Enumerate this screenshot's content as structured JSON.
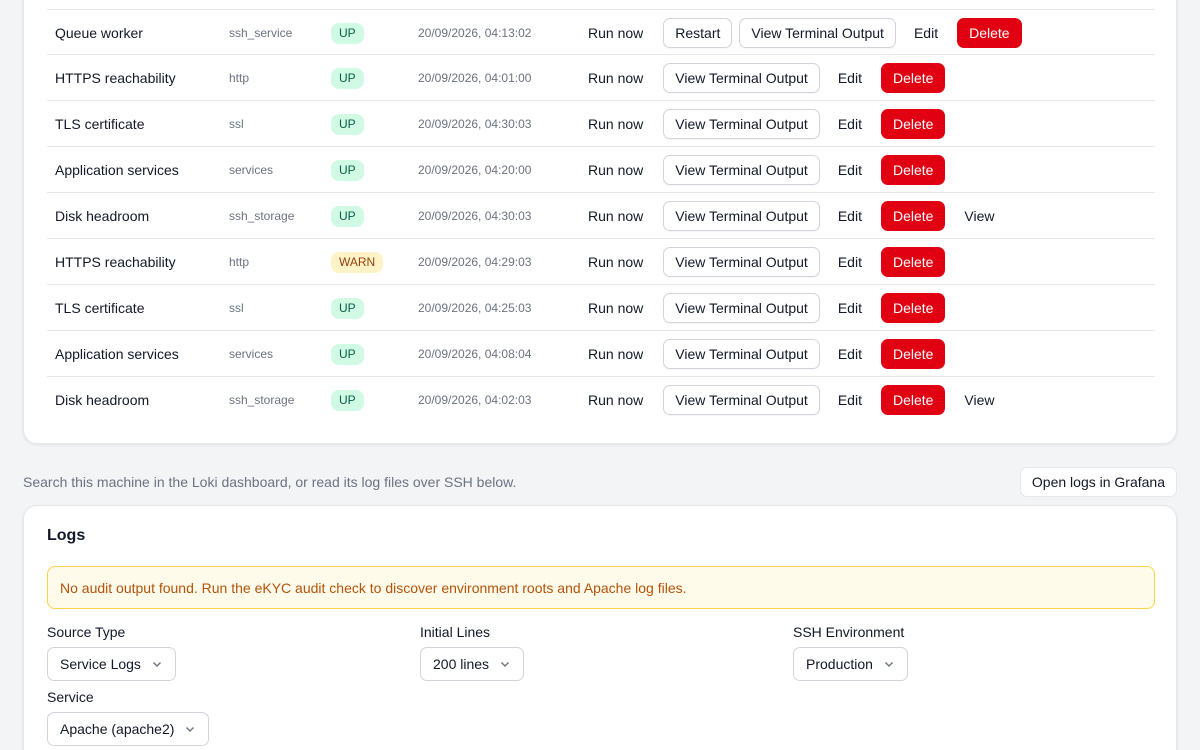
{
  "checks": [
    {
      "name": "Queue worker",
      "type": "ssh_service",
      "status": "UP",
      "time": "20/09/2026, 04:13:02",
      "restart": true,
      "view": false
    },
    {
      "name": "HTTPS reachability",
      "type": "http",
      "status": "UP",
      "time": "20/09/2026, 04:01:00",
      "restart": false,
      "view": false
    },
    {
      "name": "TLS certificate",
      "type": "ssl",
      "status": "UP",
      "time": "20/09/2026, 04:30:03",
      "restart": false,
      "view": false
    },
    {
      "name": "Application services",
      "type": "services",
      "status": "UP",
      "time": "20/09/2026, 04:20:00",
      "restart": false,
      "view": false
    },
    {
      "name": "Disk headroom",
      "type": "ssh_storage",
      "status": "UP",
      "time": "20/09/2026, 04:30:03",
      "restart": false,
      "view": true
    },
    {
      "name": "HTTPS reachability",
      "type": "http",
      "status": "WARN",
      "time": "20/09/2026, 04:29:03",
      "restart": false,
      "view": false
    },
    {
      "name": "TLS certificate",
      "type": "ssl",
      "status": "UP",
      "time": "20/09/2026, 04:25:03",
      "restart": false,
      "view": false
    },
    {
      "name": "Application services",
      "type": "services",
      "status": "UP",
      "time": "20/09/2026, 04:08:04",
      "restart": false,
      "view": false
    },
    {
      "name": "Disk headroom",
      "type": "ssh_storage",
      "status": "UP",
      "time": "20/09/2026, 04:02:03",
      "restart": false,
      "view": true
    }
  ],
  "actions": {
    "run_now": "Run now",
    "restart": "Restart",
    "terminal": "View Terminal Output",
    "edit": "Edit",
    "delete": "Delete",
    "view": "View"
  },
  "logs_intro": {
    "text": "Search this machine in the Loki dashboard, or read its log files over SSH below.",
    "grafana_button": "Open logs in Grafana"
  },
  "logs": {
    "title": "Logs",
    "alert": "No audit output found. Run the eKYC audit check to discover environment roots and Apache log files.",
    "source_type": {
      "label": "Source Type",
      "value": "Service Logs"
    },
    "initial_lines": {
      "label": "Initial Lines",
      "value": "200 lines"
    },
    "ssh_environment": {
      "label": "SSH Environment",
      "value": "Production"
    },
    "service": {
      "label": "Service",
      "value": "Apache (apache2)"
    }
  },
  "colors": {
    "danger": "#e00012",
    "up_badge": "#d1fae5",
    "warn_badge": "#fef3c7",
    "alert_bg": "#fffbeb"
  }
}
